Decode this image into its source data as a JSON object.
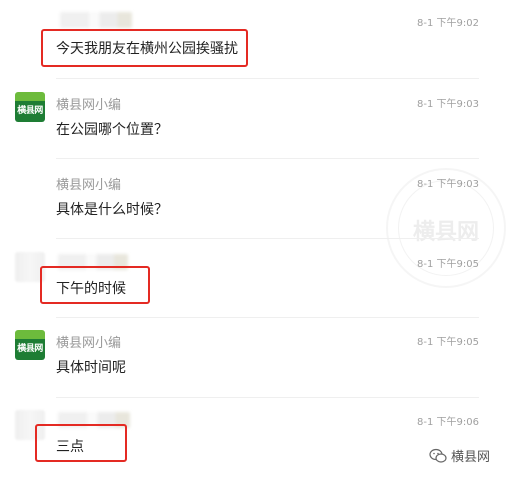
{
  "messages": [
    {
      "time": "8-1 下午9:02",
      "text": "今天我朋友在横州公园挨骚扰"
    },
    {
      "name": "横县网小编",
      "avatar_text": "横县网",
      "time": "8-1 下午9:03",
      "text": "在公园哪个位置？"
    },
    {
      "name": "横县网小编",
      "time": "8-1 下午9:03",
      "text": "具体是什么时候？"
    },
    {
      "time": "8-1 下午9:05",
      "text": "下午的时候"
    },
    {
      "name": "横县网小编",
      "avatar_text": "横县网",
      "time": "8-1 下午9:05",
      "text": "具体时间呢"
    },
    {
      "time": "8-1 下午9:06",
      "text": "三点"
    }
  ],
  "watermark_text": "横县网",
  "footer": {
    "icon": "wechat-icon",
    "label": "横县网"
  },
  "colors": {
    "highlight": "#e42a23",
    "logo_green": "#1e7d34",
    "name_gray": "#9a9a9a"
  }
}
